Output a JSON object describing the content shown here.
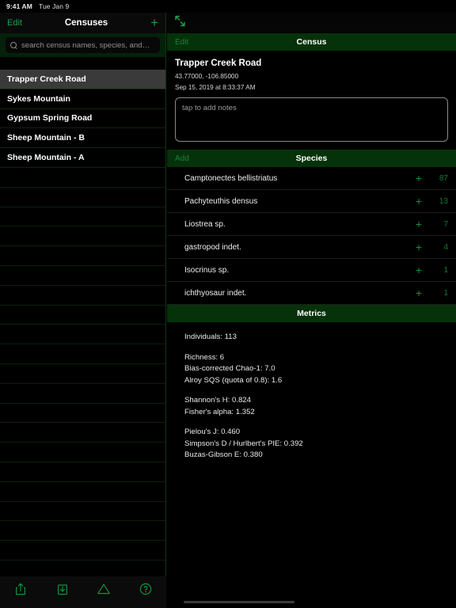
{
  "status_bar": {
    "time": "9:41 AM",
    "date": "Tue Jan 9",
    "icons": [
      "wifi-icon",
      "location-arrow-icon",
      "battery-icon"
    ]
  },
  "sidebar": {
    "nav": {
      "edit_label": "Edit",
      "title": "Censuses",
      "add_label": "+"
    },
    "search": {
      "placeholder": "search census names, species, and…",
      "value": ""
    },
    "items": [
      {
        "label": "Trapper Creek Road",
        "selected": true
      },
      {
        "label": "Sykes Mountain",
        "selected": false
      },
      {
        "label": "Gypsum Spring Road",
        "selected": false
      },
      {
        "label": "Sheep Mountain - B",
        "selected": false
      },
      {
        "label": "Sheep Mountain - A",
        "selected": false
      }
    ],
    "empty_row_count": 22,
    "toolbar": [
      {
        "icon": "share-export-icon",
        "label": "Export"
      },
      {
        "icon": "import-download-icon",
        "label": "Import"
      },
      {
        "icon": "triangle-icon",
        "label": "Analyze"
      },
      {
        "icon": "help-question-icon",
        "label": "Help"
      }
    ]
  },
  "detail": {
    "collapse_icon": "collapse-arrows-icon",
    "nav": {
      "back_label": "Edit",
      "title": "Census"
    },
    "census": {
      "name": "Trapper Creek Road",
      "coordinates": "43.77000, -106.85000",
      "datetime": "Sep 15, 2019 at 8:33:37 AM",
      "notes_placeholder": "tap to add notes",
      "notes_value": ""
    },
    "species_section": {
      "add_label": "Add",
      "title": "Species",
      "plus_glyph": "+",
      "rows": [
        {
          "name": "Camptonectes bellistriatus",
          "count": "87"
        },
        {
          "name": "Pachyteuthis densus",
          "count": "13"
        },
        {
          "name": "Liostrea sp.",
          "count": "7"
        },
        {
          "name": "gastropod indet.",
          "count": "4"
        },
        {
          "name": "Isocrinus sp.",
          "count": "1"
        },
        {
          "name": "ichthyosaur indet.",
          "count": "1"
        }
      ]
    },
    "metrics_section": {
      "title": "Metrics",
      "groups": [
        [
          "Individuals: 113"
        ],
        [
          "Richness: 6",
          "Bias-corrected Chao-1: 7.0",
          "Alroy SQS (quota of 0.8): 1.6"
        ],
        [
          "Shannon's H: 0.824",
          "Fisher's alpha: 1.352"
        ],
        [
          "Pielou's J: 0.460",
          "Simpson's D / Hurlbert's PIE: 0.392",
          "Buzas-Gibson E: 0.380"
        ]
      ]
    }
  },
  "colors": {
    "accent_green": "#1f9d4d",
    "header_green": "#053209",
    "search_bar_green": "#04220a",
    "background": "#000000",
    "selected_row": "#3a3a3a"
  }
}
